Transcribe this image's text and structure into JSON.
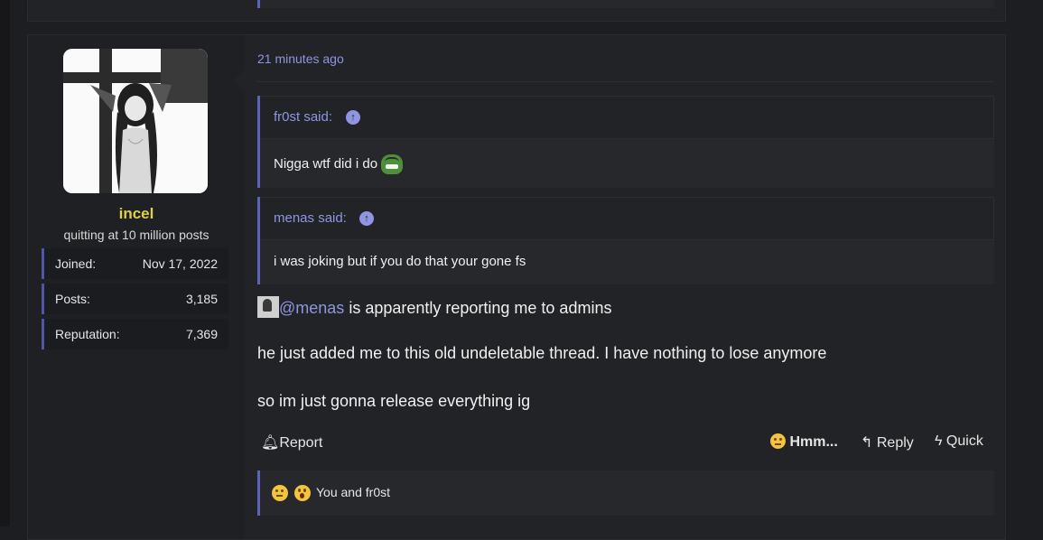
{
  "post": {
    "time": "21 minutes ago",
    "author": {
      "username": "incel",
      "title": "quitting at 10 million posts",
      "stats": [
        {
          "label": "Joined:",
          "value": "Nov 17, 2022"
        },
        {
          "label": "Posts:",
          "value": "3,185"
        },
        {
          "label": "Reputation:",
          "value": "7,369"
        }
      ]
    },
    "quotes": [
      {
        "author": "fr0st said:",
        "text": "Nigga wtf did i do",
        "icon": "frog-emoji-icon"
      },
      {
        "author": "menas said:",
        "text": "i was joking but if you do that your gone fs"
      }
    ],
    "body": {
      "line1_mention": "@menas",
      "line1_rest": " is apparently reporting me to admins",
      "line2": "he just added me to this old undeletable thread. I have nothing to lose anymore",
      "line3": "so im just gonna release everything ig"
    },
    "actions": {
      "report": "Report",
      "reaction": "Hmm...",
      "reply": "Reply",
      "quick": "Quick"
    },
    "reactions_text": "You and fr0st",
    "colors": {
      "accent": "#5d63b8",
      "link": "#8f95e0",
      "username": "#e0cf4a"
    }
  }
}
